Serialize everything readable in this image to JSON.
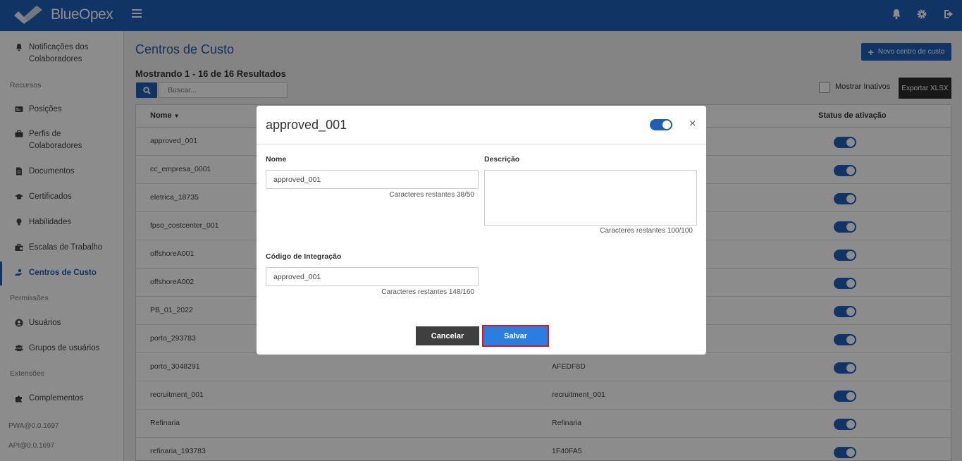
{
  "app": {
    "brand": "BlueOpex"
  },
  "colors": {
    "primary": "#1e5fb4",
    "save": "#2a7de1",
    "highlight": "#e0141c",
    "dark": "#3f3f3f"
  },
  "topbar": {
    "icons": [
      "bell-icon",
      "gear-icon",
      "sign-out-icon"
    ]
  },
  "sidebar": {
    "items": [
      {
        "label": "Notificações dos Colaboradores",
        "icon": "bell-icon"
      },
      {
        "label": "Posições",
        "icon": "id-card-icon"
      },
      {
        "label": "Perfis de Colaboradores",
        "icon": "briefcase-icon"
      },
      {
        "label": "Documentos",
        "icon": "file-icon"
      },
      {
        "label": "Certificados",
        "icon": "graduation-cap-icon"
      },
      {
        "label": "Habilidades",
        "icon": "lightbulb-icon"
      },
      {
        "label": "Escalas de Trabalho",
        "icon": "suitcase-icon"
      },
      {
        "label": "Centros de Custo",
        "icon": "hand-coin-icon"
      },
      {
        "label": "Usuários",
        "icon": "user-circle-icon"
      },
      {
        "label": "Grupos de usuários",
        "icon": "users-icon"
      },
      {
        "label": "Complementos",
        "icon": "puzzle-icon"
      }
    ],
    "sections": {
      "resources": "Recursos",
      "permissions": "Permissões",
      "extensions": "Extensões"
    },
    "versions": {
      "pwa": "PWA@0.0.1697",
      "api": "API@0.0.1697"
    }
  },
  "main": {
    "title": "Centros de Custo",
    "new_button": "Novo centro de custo",
    "results": "Mostrando 1 - 16 de 16 Resultados",
    "search_placeholder": "Buscar...",
    "show_inactive": "Mostrar Inativos",
    "export_button": "Exportar XLSX",
    "table": {
      "headers": {
        "name": "Nome",
        "status": "Status de ativação"
      },
      "rows": [
        {
          "name": "approved_001",
          "code": "",
          "active": true
        },
        {
          "name": "cc_empresa_0001",
          "code": "",
          "active": true
        },
        {
          "name": "eletrica_18735",
          "code": "",
          "active": true
        },
        {
          "name": "fpso_costcenter_001",
          "code": "",
          "active": true
        },
        {
          "name": "offshoreA001",
          "code": "",
          "active": true
        },
        {
          "name": "offshoreA002",
          "code": "",
          "active": true
        },
        {
          "name": "PB_01_2022",
          "code": "",
          "active": true
        },
        {
          "name": "porto_293783",
          "code": "",
          "active": true
        },
        {
          "name": "porto_3048291",
          "code": "AFEDF8D",
          "active": true
        },
        {
          "name": "recruitment_001",
          "code": "recruitment_001",
          "active": true
        },
        {
          "name": "Refinaria",
          "code": "Refinaria",
          "active": true
        },
        {
          "name": "refinaria_193783",
          "code": "1F40FA5",
          "active": true
        }
      ]
    }
  },
  "modal": {
    "title": "approved_001",
    "close": "×",
    "name_label": "Nome",
    "name_value": "approved_001",
    "name_hint": "Caracteres restantes 38/50",
    "desc_label": "Descrição",
    "desc_value": "",
    "desc_hint": "Caracteres restantes 100/100",
    "code_label": "Código de Integração",
    "code_value": "approved_001",
    "code_hint": "Caracteres restantes 148/160",
    "cancel": "Cancelar",
    "save": "Salvar"
  }
}
